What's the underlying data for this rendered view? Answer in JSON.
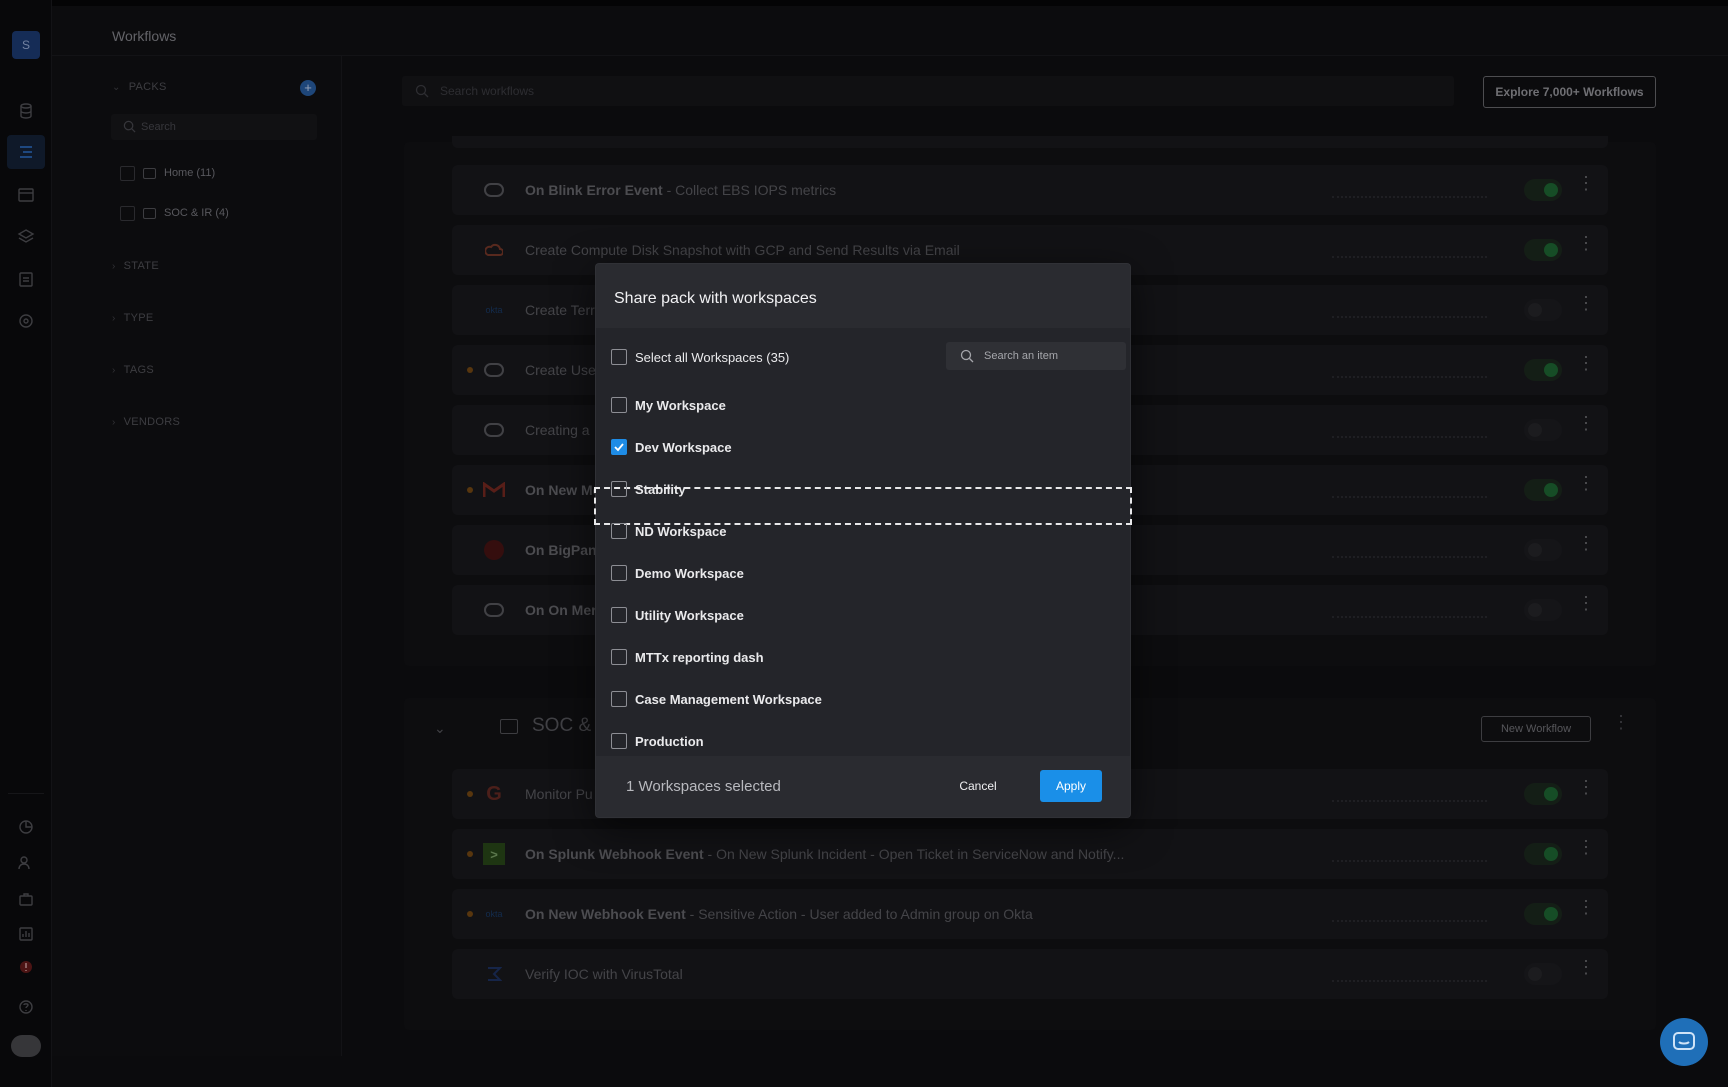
{
  "header": {
    "title": "Workflows",
    "logo_letter": "S"
  },
  "sidebar": {
    "packs_label": "PACKS",
    "search_placeholder": "Search",
    "packs": [
      {
        "label": "Home (11)"
      },
      {
        "label": "SOC & IR (4)"
      }
    ],
    "sections": [
      {
        "label": "STATE"
      },
      {
        "label": "TYPE"
      },
      {
        "label": "TAGS"
      },
      {
        "label": "VENDORS"
      }
    ]
  },
  "main": {
    "search_placeholder": "Search workflows",
    "explore_label": "Explore 7,000+ Workflows",
    "workflows": [
      {
        "bold": "On Blink Error Event",
        "rest": " - Collect EBS IOPS metrics",
        "icon": "blink-bot-icon",
        "on": true,
        "dot": false
      },
      {
        "bold": "",
        "rest": "Create Compute Disk Snapshot with GCP and Send Results via Email",
        "icon": "gcp-icon",
        "on": true,
        "dot": false
      },
      {
        "bold": "",
        "rest": "Create Terr",
        "icon": "okta-icon",
        "on": false,
        "dot": false
      },
      {
        "bold": "",
        "rest": "Create Use",
        "icon": "blink-bot-icon",
        "on": true,
        "dot": true
      },
      {
        "bold": "",
        "rest": "Creating a",
        "icon": "blink-bot-icon",
        "on": false,
        "dot": false
      },
      {
        "bold": "On New Me",
        "rest": "",
        "icon": "gmail-icon",
        "on": true,
        "dot": true
      },
      {
        "bold": "On BigPand",
        "rest": "",
        "icon": "bigpanda-icon",
        "on": false,
        "dot": false
      },
      {
        "bold": "On On Merg",
        "rest": "",
        "icon": "blink-bot-icon",
        "on": false,
        "dot": false
      }
    ],
    "soc_pack": {
      "title": "SOC & IR",
      "new_workflow_label": "New Workflow",
      "workflows": [
        {
          "bold": "",
          "rest": "Monitor Pu",
          "icon": "google-icon",
          "on": true,
          "dot": true
        },
        {
          "bold": "On Splunk Webhook Event",
          "rest": " - On New Splunk Incident - Open Ticket in ServiceNow and Notify...",
          "icon": "splunk-icon",
          "on": true,
          "dot": true
        },
        {
          "bold": "On New Webhook Event",
          "rest": " - Sensitive Action - User added to Admin group on Okta",
          "icon": "okta-icon",
          "on": true,
          "dot": true
        },
        {
          "bold": "",
          "rest": "Verify IOC with VirusTotal",
          "icon": "virustotal-icon",
          "on": false,
          "dot": false
        }
      ]
    }
  },
  "modal": {
    "title": "Share pack with workspaces",
    "select_all_label": "Select all Workspaces (35)",
    "search_placeholder": "Search an item",
    "workspaces": [
      {
        "label": "My Workspace",
        "checked": false
      },
      {
        "label": "Dev Workspace",
        "checked": true
      },
      {
        "label": "Stability",
        "checked": false
      },
      {
        "label": "ND Workspace",
        "checked": false
      },
      {
        "label": "Demo Workspace",
        "checked": false
      },
      {
        "label": "Utility Workspace",
        "checked": false
      },
      {
        "label": "MTTx reporting dash",
        "checked": false
      },
      {
        "label": "Case Management Workspace",
        "checked": false
      },
      {
        "label": "Production",
        "checked": false
      }
    ],
    "selected_count_text": "1 Workspaces selected",
    "cancel_label": "Cancel",
    "apply_label": "Apply"
  },
  "colors": {
    "accent": "#1a8fe8",
    "toggle_on": "#1f6b35",
    "modal_bg": "#2a2b30"
  }
}
